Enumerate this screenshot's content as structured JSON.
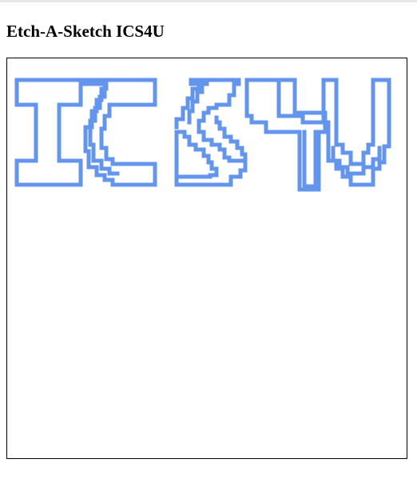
{
  "page": {
    "title": "Etch-A-Sketch ICS4U"
  },
  "sketch": {
    "stroke_color": "#6495ED",
    "background_color": "#FFFFFF",
    "border_color": "#000000",
    "drawn_text": "ICS4U"
  }
}
